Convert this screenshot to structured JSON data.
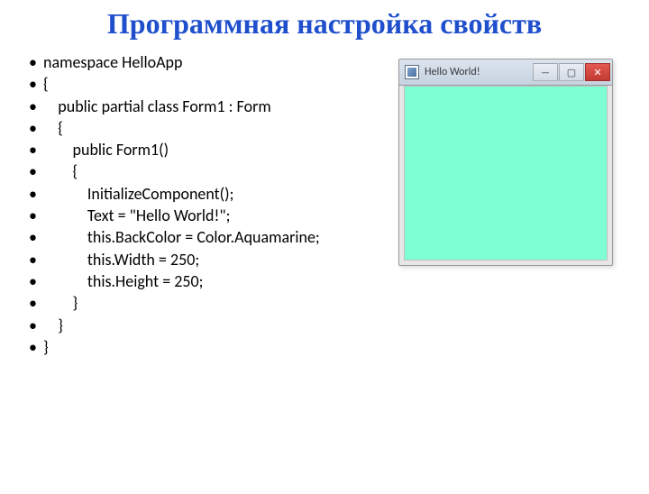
{
  "title": "Программная настройка свойств",
  "code": {
    "l0": "namespace HelloApp",
    "l1": "{",
    "l2": "    public partial class Form1 : Form",
    "l3": "    {",
    "l4": "        public Form1()",
    "l5": "        {",
    "l6": "            InitializeComponent();",
    "l7": "            Text = \"Hello World!\";",
    "l8": "            this.BackColor = Color.Aquamarine;",
    "l9": "            this.Width = 250;",
    "l10": "            this.Height = 250;",
    "l11": "        }",
    "l12": "    }",
    "l13": "}"
  },
  "window": {
    "title": "Hello World!",
    "min": "—",
    "max": "▢",
    "close": "✕"
  }
}
